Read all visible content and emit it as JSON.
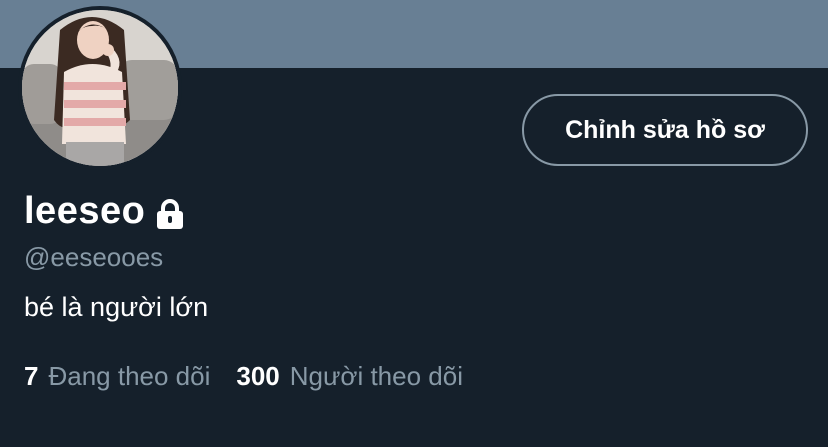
{
  "profile": {
    "display_name": "leeseo",
    "handle": "@eeseooes",
    "bio": "bé là người lớn",
    "protected_icon": "lock-icon",
    "avatar": "avatar-photo"
  },
  "actions": {
    "edit_profile_label": "Chỉnh sửa hồ sơ"
  },
  "stats": {
    "following_count": "7",
    "following_label": "Đang theo dõi",
    "followers_count": "300",
    "followers_label": "Người theo dõi"
  },
  "colors": {
    "background": "#15202b",
    "banner": "#687f94",
    "secondary_text": "#8899a6",
    "primary_text": "#ffffff"
  }
}
